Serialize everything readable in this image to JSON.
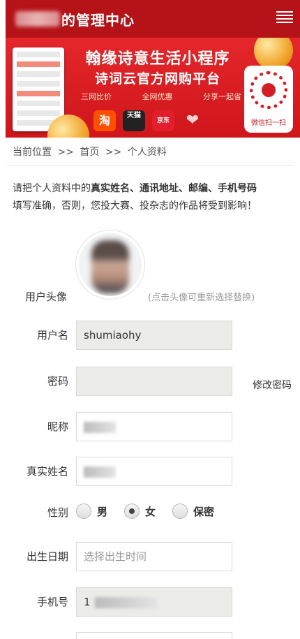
{
  "header": {
    "title": "的管理中心",
    "menu_icon": "hamburger-menu-icon"
  },
  "banner": {
    "headline": "翰缘诗意生活小程序",
    "subheadline": "诗词云官方网购平台",
    "tags": [
      "三网比价",
      "全网优惠",
      "分享一起省"
    ],
    "shops": [
      "淘",
      "天猫",
      "京东",
      "❤"
    ],
    "qr_caption": "微信扫一扫"
  },
  "breadcrumb": {
    "current_label": "当前位置",
    "sep1": ">>",
    "home": "首页",
    "sep2": ">>",
    "page": "个人资料"
  },
  "notice": {
    "prefix": "请把个人资料中的",
    "emphasis": "真实姓名、通讯地址、邮编、手机号码",
    "suffix": "填写准确，否则，您投大赛、投杂志的作品将受到影响！"
  },
  "avatar": {
    "label": "用户头像",
    "hint": "(点击头像可重新选择替换)"
  },
  "form": {
    "username_label": "用户名",
    "username_value": "shumiaohy",
    "password_label": "密码",
    "change_password": "修改密码",
    "nickname_label": "昵称",
    "realname_label": "真实姓名",
    "gender_label": "性别",
    "gender_options": [
      "男",
      "女",
      "保密"
    ],
    "gender_selected": "女",
    "birthday_label": "出生日期",
    "birthday_placeholder": "选择出生时间",
    "phone_label": "手机号",
    "phone_prefix": "1"
  }
}
